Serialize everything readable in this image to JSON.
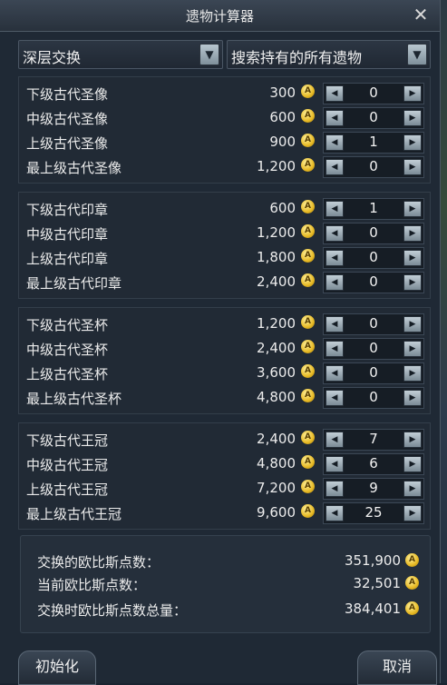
{
  "window": {
    "title": "遗物计算器"
  },
  "filters": {
    "mode": "深层交换",
    "scope": "搜索持有的所有遗物"
  },
  "groups": [
    {
      "items": [
        {
          "name": "下级古代圣像",
          "cost": "300",
          "qty": "0"
        },
        {
          "name": "中级古代圣像",
          "cost": "600",
          "qty": "0"
        },
        {
          "name": "上级古代圣像",
          "cost": "900",
          "qty": "1"
        },
        {
          "name": "最上级古代圣像",
          "cost": "1,200",
          "qty": "0"
        }
      ]
    },
    {
      "items": [
        {
          "name": "下级古代印章",
          "cost": "600",
          "qty": "1"
        },
        {
          "name": "中级古代印章",
          "cost": "1,200",
          "qty": "0"
        },
        {
          "name": "上级古代印章",
          "cost": "1,800",
          "qty": "0"
        },
        {
          "name": "最上级古代印章",
          "cost": "2,400",
          "qty": "0"
        }
      ]
    },
    {
      "items": [
        {
          "name": "下级古代圣杯",
          "cost": "1,200",
          "qty": "0"
        },
        {
          "name": "中级古代圣杯",
          "cost": "2,400",
          "qty": "0"
        },
        {
          "name": "上级古代圣杯",
          "cost": "3,600",
          "qty": "0"
        },
        {
          "name": "最上级古代圣杯",
          "cost": "4,800",
          "qty": "0"
        }
      ]
    },
    {
      "items": [
        {
          "name": "下级古代王冠",
          "cost": "2,400",
          "qty": "7"
        },
        {
          "name": "中级古代王冠",
          "cost": "4,800",
          "qty": "6"
        },
        {
          "name": "上级古代王冠",
          "cost": "7,200",
          "qty": "9"
        },
        {
          "name": "最上级古代王冠",
          "cost": "9,600",
          "qty": "25"
        }
      ]
    }
  ],
  "summary": [
    {
      "label": "交换的欧比斯点数：",
      "value": "351,900"
    },
    {
      "label": "当前欧比斯点数：",
      "value": "32,501"
    },
    {
      "label": "交换时欧比斯点数总量：",
      "value": "384,401"
    }
  ],
  "buttons": {
    "reset": "初始化",
    "cancel": "取消"
  },
  "icons": {
    "coin": "coin-icon",
    "close": "close-icon",
    "left": "arrow-left-icon",
    "right": "arrow-right-icon",
    "dropdown": "chevron-down-icon"
  },
  "coin_glyph": "A",
  "close_glyph": "✕",
  "left_glyph": "◀",
  "right_glyph": "▶",
  "dropdown_glyph": "▼"
}
